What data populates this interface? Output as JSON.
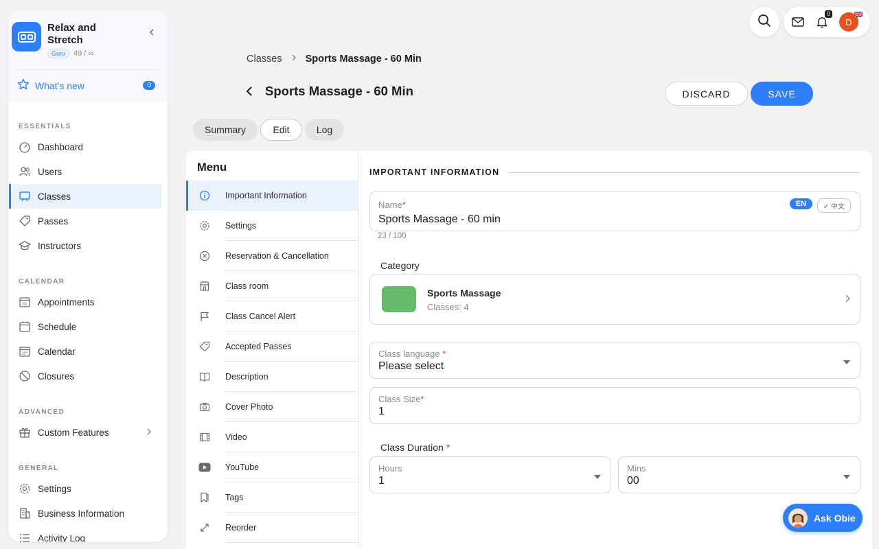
{
  "sidebar": {
    "brand_name": "Relax and Stretch",
    "plan_badge": "Guru",
    "usage": "49 / ∞",
    "whats_new": {
      "label": "What's new",
      "count": "0"
    },
    "sections": {
      "essentials": "ESSENTIALS",
      "calendar": "CALENDAR",
      "advanced": "ADVANCED",
      "general": "GENERAL"
    },
    "items": {
      "dashboard": "Dashboard",
      "users": "Users",
      "classes": "Classes",
      "passes": "Passes",
      "instructors": "Instructors",
      "appointments": "Appointments",
      "schedule": "Schedule",
      "calendar": "Calendar",
      "closures": "Closures",
      "custom_features": "Custom Features",
      "settings": "Settings",
      "business_information": "Business Information",
      "activity_log": "Activity Log"
    }
  },
  "header": {
    "notification_count": "0",
    "avatar_initial": "D"
  },
  "breadcrumb": {
    "parent": "Classes",
    "current": "Sports Massage - 60 Min"
  },
  "page": {
    "title": "Sports Massage - 60 Min",
    "discard_label": "DISCARD",
    "save_label": "SAVE"
  },
  "tabs": {
    "summary": "Summary",
    "edit": "Edit",
    "log": "Log"
  },
  "menu": {
    "title": "Menu",
    "items": [
      "Important Information",
      "Settings",
      "Reservation & Cancellation",
      "Class room",
      "Class Cancel Alert",
      "Accepted Passes",
      "Description",
      "Cover Photo",
      "Video",
      "YouTube",
      "Tags",
      "Reorder"
    ]
  },
  "form": {
    "section_title": "IMPORTANT INFORMATION",
    "name": {
      "label": "Name",
      "value": "Sports Massage - 60 min",
      "counter": "23 / 100",
      "lang_active": "EN",
      "lang_other": "✓ 中文"
    },
    "category": {
      "label": "Category",
      "name": "Sports Massage",
      "count": "Classes: 4",
      "color": "#66bb6a"
    },
    "class_language": {
      "label": "Class language",
      "value": "Please select"
    },
    "class_size": {
      "label": "Class Size",
      "value": "1"
    },
    "class_duration": {
      "label": "Class Duration",
      "hours": {
        "label": "Hours",
        "value": "1"
      },
      "mins": {
        "label": "Mins",
        "value": "00"
      }
    }
  },
  "assistant": {
    "label": "Ask Obie"
  },
  "colors": {
    "accent": "#2d7ff9",
    "avatar": "#e8501d",
    "required": "#e53935"
  }
}
